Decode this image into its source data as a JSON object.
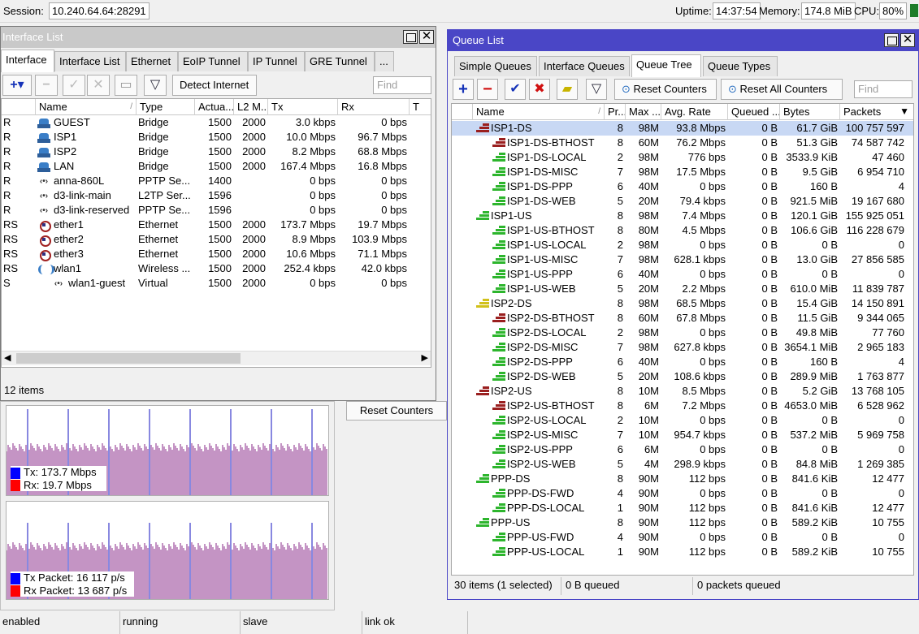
{
  "topbar": {
    "session_label": "Session:",
    "session_value": "10.240.64.64:28291",
    "uptime_label": "Uptime:",
    "uptime_value": "14:37:54",
    "memory_label": "Memory:",
    "memory_value": "174.8 MiB",
    "cpu_label": "CPU:",
    "cpu_value": "80%"
  },
  "interface_window": {
    "title": "Interface List",
    "tabs": [
      "Interface",
      "Interface List",
      "Ethernet",
      "EoIP Tunnel",
      "IP Tunnel",
      "GRE Tunnel",
      "..."
    ],
    "detect_button": "Detect Internet",
    "find_placeholder": "Find",
    "columns": [
      "",
      "Name",
      "Type",
      "Actua...",
      "L2 M...",
      "Tx",
      "Rx",
      "T"
    ],
    "rows": [
      {
        "flag": "R",
        "icon": "bridge",
        "name": "GUEST",
        "type": "Bridge",
        "actual": "1500",
        "l2": "2000",
        "tx": "3.0 kbps",
        "rx": "0 bps"
      },
      {
        "flag": "R",
        "icon": "bridge",
        "name": "ISP1",
        "type": "Bridge",
        "actual": "1500",
        "l2": "2000",
        "tx": "10.0 Mbps",
        "rx": "96.7 Mbps"
      },
      {
        "flag": "R",
        "icon": "bridge",
        "name": "ISP2",
        "type": "Bridge",
        "actual": "1500",
        "l2": "2000",
        "tx": "8.2 Mbps",
        "rx": "68.8 Mbps"
      },
      {
        "flag": "R",
        "icon": "bridge",
        "name": "LAN",
        "type": "Bridge",
        "actual": "1500",
        "l2": "2000",
        "tx": "167.4 Mbps",
        "rx": "16.8 Mbps"
      },
      {
        "flag": "R",
        "icon": "ppp",
        "name": "anna-860L",
        "type": "PPTP Se...",
        "actual": "1400",
        "l2": "",
        "tx": "0 bps",
        "rx": "0 bps"
      },
      {
        "flag": "R",
        "icon": "ppp",
        "name": "d3-link-main",
        "type": "L2TP Ser...",
        "actual": "1596",
        "l2": "",
        "tx": "0 bps",
        "rx": "0 bps"
      },
      {
        "flag": "R",
        "icon": "ppp",
        "name": "d3-link-reserved",
        "type": "PPTP Se...",
        "actual": "1596",
        "l2": "",
        "tx": "0 bps",
        "rx": "0 bps"
      },
      {
        "flag": "RS",
        "icon": "eth",
        "name": "ether1",
        "type": "Ethernet",
        "actual": "1500",
        "l2": "2000",
        "tx": "173.7 Mbps",
        "rx": "19.7 Mbps"
      },
      {
        "flag": "RS",
        "icon": "eth",
        "name": "ether2",
        "type": "Ethernet",
        "actual": "1500",
        "l2": "2000",
        "tx": "8.9 Mbps",
        "rx": "103.9 Mbps"
      },
      {
        "flag": "RS",
        "icon": "eth",
        "name": "ether3",
        "type": "Ethernet",
        "actual": "1500",
        "l2": "2000",
        "tx": "10.6 Mbps",
        "rx": "71.1 Mbps"
      },
      {
        "flag": "RS",
        "icon": "wifi",
        "name": "wlan1",
        "type": "Wireless ...",
        "actual": "1500",
        "l2": "2000",
        "tx": "252.4 kbps",
        "rx": "42.0 kbps"
      },
      {
        "flag": "S",
        "icon": "ppp",
        "name": "wlan1-guest",
        "type": "Virtual",
        "actual": "1500",
        "l2": "2000",
        "tx": "0 bps",
        "rx": "0 bps",
        "indent": true
      }
    ],
    "item_count": "12 items"
  },
  "traffic_graph": {
    "tx_label": "Tx:",
    "tx_value": "173.7 Mbps",
    "rx_label": "Rx:",
    "rx_value": "19.7 Mbps",
    "tx_packet_label": "Tx Packet:",
    "tx_packet_value": "16 117 p/s",
    "rx_packet_label": "Rx Packet:",
    "rx_packet_value": "13 687 p/s",
    "tx_color": "#0000ff",
    "rx_color": "#ff0000"
  },
  "bg_reset_counters": "Reset Counters",
  "bottom_status": [
    "enabled",
    "running",
    "slave",
    "link ok"
  ],
  "queue_window": {
    "title": "Queue List",
    "tabs": [
      "Simple Queues",
      "Interface Queues",
      "Queue Tree",
      "Queue Types"
    ],
    "reset_counters": "Reset Counters",
    "reset_all_counters": "Reset All Counters",
    "find_placeholder": "Find",
    "columns": [
      "Name",
      "Pr...",
      "Max ...",
      "Avg. Rate",
      "Queued ...",
      "Bytes",
      "Packets"
    ],
    "rows": [
      {
        "level": 0,
        "color": "red",
        "name": "ISP1-DS",
        "pr": "8",
        "max": "98M",
        "avg": "93.8 Mbps",
        "queued": "0 B",
        "bytes": "61.7 GiB",
        "packets": "100 757 597",
        "selected": true
      },
      {
        "level": 1,
        "color": "red",
        "name": "ISP1-DS-BTHOST",
        "pr": "8",
        "max": "60M",
        "avg": "76.2 Mbps",
        "queued": "0 B",
        "bytes": "51.3 GiB",
        "packets": "74 587 742"
      },
      {
        "level": 1,
        "color": "green",
        "name": "ISP1-DS-LOCAL",
        "pr": "2",
        "max": "98M",
        "avg": "776 bps",
        "queued": "0 B",
        "bytes": "3533.9 KiB",
        "packets": "47 460"
      },
      {
        "level": 1,
        "color": "green",
        "name": "ISP1-DS-MISC",
        "pr": "7",
        "max": "98M",
        "avg": "17.5 Mbps",
        "queued": "0 B",
        "bytes": "9.5 GiB",
        "packets": "6 954 710"
      },
      {
        "level": 1,
        "color": "green",
        "name": "ISP1-DS-PPP",
        "pr": "6",
        "max": "40M",
        "avg": "0 bps",
        "queued": "0 B",
        "bytes": "160 B",
        "packets": "4"
      },
      {
        "level": 1,
        "color": "green",
        "name": "ISP1-DS-WEB",
        "pr": "5",
        "max": "20M",
        "avg": "79.4 kbps",
        "queued": "0 B",
        "bytes": "921.5 MiB",
        "packets": "19 167 680"
      },
      {
        "level": 0,
        "color": "green",
        "name": "ISP1-US",
        "pr": "8",
        "max": "98M",
        "avg": "7.4 Mbps",
        "queued": "0 B",
        "bytes": "120.1 GiB",
        "packets": "155 925 051"
      },
      {
        "level": 1,
        "color": "green",
        "name": "ISP1-US-BTHOST",
        "pr": "8",
        "max": "80M",
        "avg": "4.5 Mbps",
        "queued": "0 B",
        "bytes": "106.6 GiB",
        "packets": "116 228 679"
      },
      {
        "level": 1,
        "color": "green",
        "name": "ISP1-US-LOCAL",
        "pr": "2",
        "max": "98M",
        "avg": "0 bps",
        "queued": "0 B",
        "bytes": "0 B",
        "packets": "0"
      },
      {
        "level": 1,
        "color": "green",
        "name": "ISP1-US-MISC",
        "pr": "7",
        "max": "98M",
        "avg": "628.1 kbps",
        "queued": "0 B",
        "bytes": "13.0 GiB",
        "packets": "27 856 585"
      },
      {
        "level": 1,
        "color": "green",
        "name": "ISP1-US-PPP",
        "pr": "6",
        "max": "40M",
        "avg": "0 bps",
        "queued": "0 B",
        "bytes": "0 B",
        "packets": "0"
      },
      {
        "level": 1,
        "color": "green",
        "name": "ISP1-US-WEB",
        "pr": "5",
        "max": "20M",
        "avg": "2.2 Mbps",
        "queued": "0 B",
        "bytes": "610.0 MiB",
        "packets": "11 839 787"
      },
      {
        "level": 0,
        "color": "yellow",
        "name": "ISP2-DS",
        "pr": "8",
        "max": "98M",
        "avg": "68.5 Mbps",
        "queued": "0 B",
        "bytes": "15.4 GiB",
        "packets": "14 150 891"
      },
      {
        "level": 1,
        "color": "red",
        "name": "ISP2-DS-BTHOST",
        "pr": "8",
        "max": "60M",
        "avg": "67.8 Mbps",
        "queued": "0 B",
        "bytes": "11.5 GiB",
        "packets": "9 344 065"
      },
      {
        "level": 1,
        "color": "green",
        "name": "ISP2-DS-LOCAL",
        "pr": "2",
        "max": "98M",
        "avg": "0 bps",
        "queued": "0 B",
        "bytes": "49.8 MiB",
        "packets": "77 760"
      },
      {
        "level": 1,
        "color": "green",
        "name": "ISP2-DS-MISC",
        "pr": "7",
        "max": "98M",
        "avg": "627.8 kbps",
        "queued": "0 B",
        "bytes": "3654.1 MiB",
        "packets": "2 965 183"
      },
      {
        "level": 1,
        "color": "green",
        "name": "ISP2-DS-PPP",
        "pr": "6",
        "max": "40M",
        "avg": "0 bps",
        "queued": "0 B",
        "bytes": "160 B",
        "packets": "4"
      },
      {
        "level": 1,
        "color": "green",
        "name": "ISP2-DS-WEB",
        "pr": "5",
        "max": "20M",
        "avg": "108.6 kbps",
        "queued": "0 B",
        "bytes": "289.9 MiB",
        "packets": "1 763 877"
      },
      {
        "level": 0,
        "color": "red",
        "name": "ISP2-US",
        "pr": "8",
        "max": "10M",
        "avg": "8.5 Mbps",
        "queued": "0 B",
        "bytes": "5.2 GiB",
        "packets": "13 768 105"
      },
      {
        "level": 1,
        "color": "red",
        "name": "ISP2-US-BTHOST",
        "pr": "8",
        "max": "6M",
        "avg": "7.2 Mbps",
        "queued": "0 B",
        "bytes": "4653.0 MiB",
        "packets": "6 528 962"
      },
      {
        "level": 1,
        "color": "green",
        "name": "ISP2-US-LOCAL",
        "pr": "2",
        "max": "10M",
        "avg": "0 bps",
        "queued": "0 B",
        "bytes": "0 B",
        "packets": "0"
      },
      {
        "level": 1,
        "color": "green",
        "name": "ISP2-US-MISC",
        "pr": "7",
        "max": "10M",
        "avg": "954.7 kbps",
        "queued": "0 B",
        "bytes": "537.2 MiB",
        "packets": "5 969 758"
      },
      {
        "level": 1,
        "color": "green",
        "name": "ISP2-US-PPP",
        "pr": "6",
        "max": "6M",
        "avg": "0 bps",
        "queued": "0 B",
        "bytes": "0 B",
        "packets": "0"
      },
      {
        "level": 1,
        "color": "green",
        "name": "ISP2-US-WEB",
        "pr": "5",
        "max": "4M",
        "avg": "298.9 kbps",
        "queued": "0 B",
        "bytes": "84.8 MiB",
        "packets": "1 269 385"
      },
      {
        "level": 0,
        "color": "green",
        "name": "PPP-DS",
        "pr": "8",
        "max": "90M",
        "avg": "112 bps",
        "queued": "0 B",
        "bytes": "841.6 KiB",
        "packets": "12 477"
      },
      {
        "level": 1,
        "color": "green",
        "name": "PPP-DS-FWD",
        "pr": "4",
        "max": "90M",
        "avg": "0 bps",
        "queued": "0 B",
        "bytes": "0 B",
        "packets": "0"
      },
      {
        "level": 1,
        "color": "green",
        "name": "PPP-DS-LOCAL",
        "pr": "1",
        "max": "90M",
        "avg": "112 bps",
        "queued": "0 B",
        "bytes": "841.6 KiB",
        "packets": "12 477"
      },
      {
        "level": 0,
        "color": "green",
        "name": "PPP-US",
        "pr": "8",
        "max": "90M",
        "avg": "112 bps",
        "queued": "0 B",
        "bytes": "589.2 KiB",
        "packets": "10 755"
      },
      {
        "level": 1,
        "color": "green",
        "name": "PPP-US-FWD",
        "pr": "4",
        "max": "90M",
        "avg": "0 bps",
        "queued": "0 B",
        "bytes": "0 B",
        "packets": "0"
      },
      {
        "level": 1,
        "color": "green",
        "name": "PPP-US-LOCAL",
        "pr": "1",
        "max": "90M",
        "avg": "112 bps",
        "queued": "0 B",
        "bytes": "589.2 KiB",
        "packets": "10 755"
      }
    ],
    "status_items": "30 items (1 selected)",
    "status_queued": "0 B queued",
    "status_packets": "0 packets queued"
  }
}
